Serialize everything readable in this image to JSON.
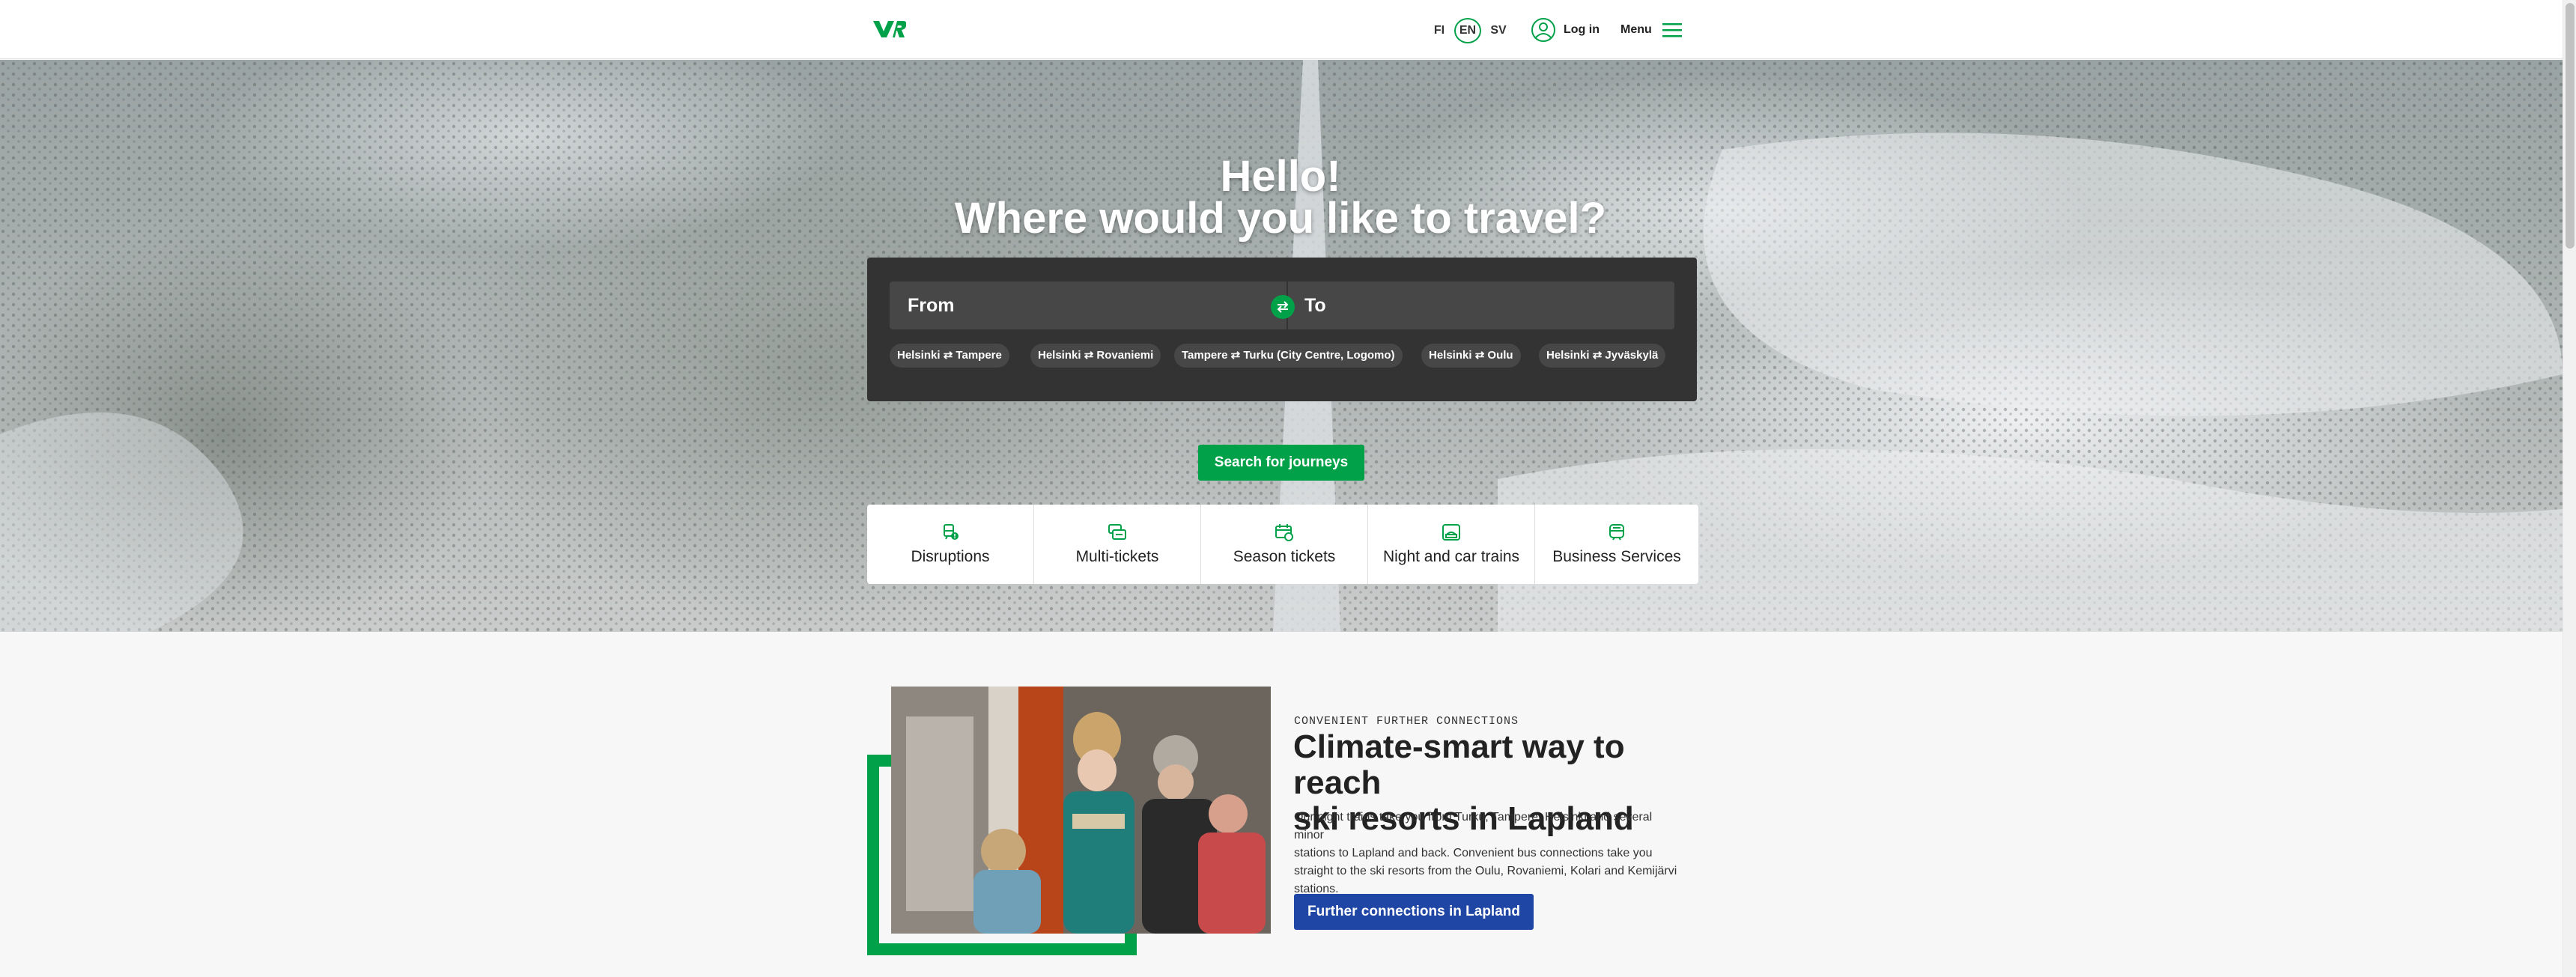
{
  "header": {
    "languages": [
      {
        "code": "FI"
      },
      {
        "code": "EN",
        "active": true
      },
      {
        "code": "SV"
      }
    ],
    "login_label": "Log in",
    "menu_label": "Menu"
  },
  "hero": {
    "greeting": "Hello!",
    "question": "Where would you like to travel?",
    "from_placeholder": "From",
    "to_placeholder": "To",
    "popular_routes": [
      "Helsinki ⇄ Tampere",
      "Helsinki ⇄ Rovaniemi",
      "Tampere ⇄ Turku (City Centre, Logomo)",
      "Helsinki ⇄ Oulu",
      "Helsinki ⇄ Jyväskylä"
    ],
    "search_label": "Search for journeys",
    "quick_links": [
      {
        "label": "Disruptions",
        "icon": "disruption-train-icon"
      },
      {
        "label": "Multi-tickets",
        "icon": "multi-ticket-icon"
      },
      {
        "label": "Season tickets",
        "icon": "season-ticket-icon"
      },
      {
        "label": "Night and car trains",
        "icon": "night-train-icon"
      },
      {
        "label": "Business Services",
        "icon": "business-train-icon"
      }
    ]
  },
  "feature": {
    "eyebrow": "CONVENIENT FURTHER CONNECTIONS",
    "headline_line1": "Climate-smart way to reach",
    "headline_line2": "ski resorts in Lapland",
    "body_line1": "Our night trains take you from Turku, Tampere, Helsinki and several minor",
    "body_line2": "stations to Lapland and back. Convenient bus connections take you",
    "body_line3": "straight to the ski resorts from the Oulu, Rovaniemi, Kolari and Kemijärvi",
    "body_line4": "stations.",
    "cta_label": "Further connections in Lapland"
  },
  "colors": {
    "brand_green": "#00a149",
    "cta_blue": "#1f45a5",
    "panel_dark": "#333333"
  }
}
